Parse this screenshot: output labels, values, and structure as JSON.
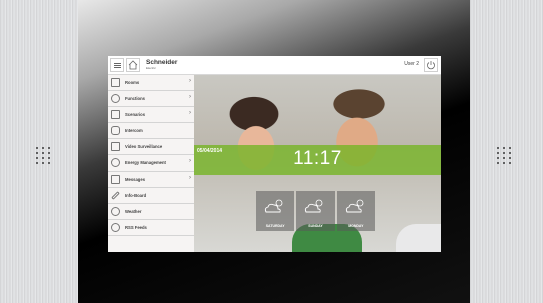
{
  "header": {
    "logo_text": "Schneider",
    "logo_sub": "Electric",
    "user_label": "User 2"
  },
  "sidebar": {
    "items": [
      {
        "label": "Rooms",
        "icon": "floorplan-icon",
        "has_submenu": true
      },
      {
        "label": "Functions",
        "icon": "bulb-icon",
        "has_submenu": true
      },
      {
        "label": "Scenarios",
        "icon": "grid-icon",
        "has_submenu": true
      },
      {
        "label": "Intercom",
        "icon": "phone-icon",
        "has_submenu": false
      },
      {
        "label": "Video Surveillance",
        "icon": "camera-icon",
        "has_submenu": false
      },
      {
        "label": "Energy Management",
        "icon": "gear-icon",
        "has_submenu": true
      },
      {
        "label": "Messages",
        "icon": "envelope-icon",
        "has_submenu": true
      },
      {
        "label": "Info-Board",
        "icon": "pen-icon",
        "has_submenu": false
      },
      {
        "label": "Weather",
        "icon": "cloud-icon",
        "has_submenu": false
      },
      {
        "label": "RSS Feeds",
        "icon": "rss-icon",
        "has_submenu": false
      }
    ]
  },
  "clock": {
    "date": "05/04/2014",
    "time": "11:17",
    "band_color": "#78b428"
  },
  "weather": {
    "days": [
      {
        "label": "SATURDAY",
        "icon": "sun-cloud-icon"
      },
      {
        "label": "SUNDAY",
        "icon": "sun-cloud-icon"
      },
      {
        "label": "MONDAY",
        "icon": "sun-cloud-icon"
      }
    ]
  }
}
